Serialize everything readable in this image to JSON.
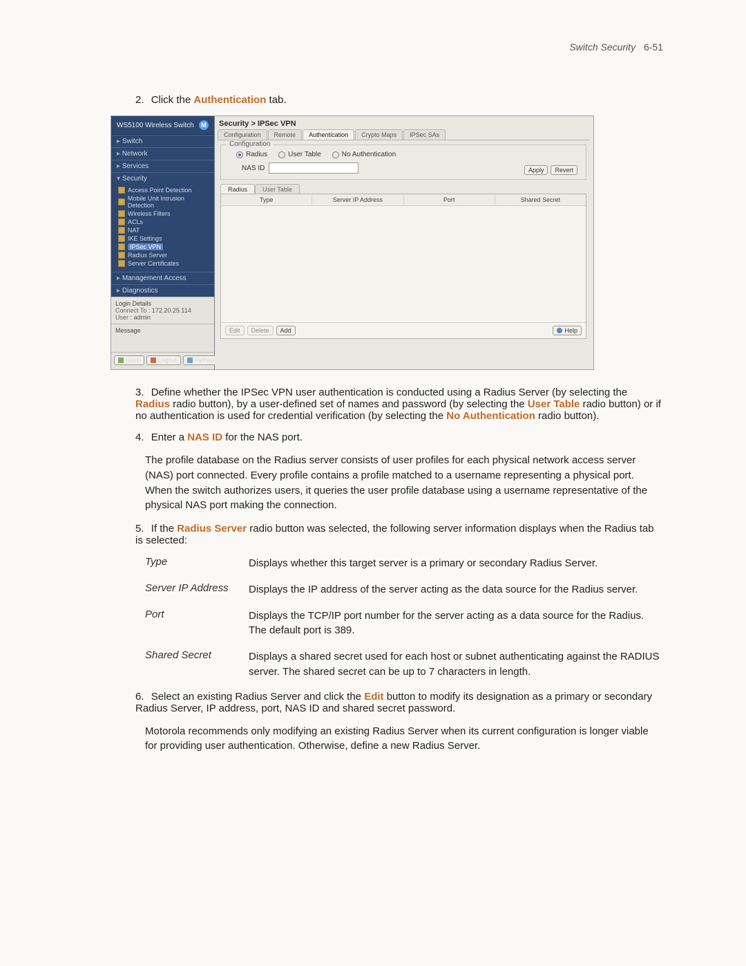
{
  "header": {
    "section": "Switch Security",
    "pageref": "6-51"
  },
  "steps": {
    "s2": {
      "num": "2.",
      "prefix": "Click the ",
      "accent": "Authentication",
      "suffix": " tab."
    },
    "s3": {
      "num": "3.",
      "t1": "Define whether the IPSec VPN user authentication is conducted using a Radius Server (by selecting the ",
      "a1": "Radius",
      "t2": " radio button), by a user-defined set of names and password (by selecting the ",
      "a2": "User Table",
      "t3": " radio button) or if no authentication is used for credential verification (by selecting the ",
      "a3": "No Authentication",
      "t4": " radio button)."
    },
    "s4": {
      "num": "4.",
      "t1": "Enter a ",
      "a1": "NAS ID",
      "t2": " for the NAS port.",
      "para": "The profile database on the Radius server consists of user profiles for each physical network access server (NAS) port connected. Every profile contains a profile matched to a username representing a physical port. When the switch authorizes users, it queries the user profile database using a username representative of the physical NAS port making the connection."
    },
    "s5": {
      "num": "5.",
      "t1": "If the ",
      "a1": "Radius Server",
      "t2": " radio button was selected, the following server information displays when the Radius tab is selected:"
    },
    "s6": {
      "num": "6.",
      "t1": "Select an existing Radius Server and click the ",
      "a1": "Edit",
      "t2": " button to modify its designation as a primary or secondary Radius Server, IP address, port, NAS ID and shared secret password.",
      "para": "Motorola recommends only modifying an existing Radius Server when its current configuration is longer viable for providing user authentication. Otherwise, define a new Radius Server."
    }
  },
  "defs": [
    {
      "term": "Type",
      "def": "Displays whether this target server is a primary or secondary Radius Server."
    },
    {
      "term": "Server IP Address",
      "def": "Displays the IP address of the server acting as the data source for the Radius server."
    },
    {
      "term": "Port",
      "def": "Displays the TCP/IP port number for the server acting as a data source for the Radius. The default port is 389."
    },
    {
      "term": "Shared Secret",
      "def": "Displays a shared secret used for each host or subnet authenticating against the RADIUS server. The shared secret can be up to 7 characters in length."
    }
  ],
  "ui": {
    "brand": {
      "name": "WS5100 Wireless Switch",
      "logoLetter": "M"
    },
    "nav": {
      "items": [
        "Switch",
        "Network",
        "Services",
        "Security",
        "Management Access",
        "Diagnostics"
      ],
      "tree": [
        "Access Point Detection",
        "Mobile Unit Intrusion Detection",
        "Wireless Filters",
        "ACLs",
        "NAT",
        "IKE Settings",
        "IPSec VPN",
        "Radius Server",
        "Server Certificates"
      ]
    },
    "login": {
      "title": "Login Details",
      "connectLbl": "Connect To :",
      "connectVal": "172.20.25.114",
      "userLbl": "User :",
      "userVal": "admin"
    },
    "message": {
      "title": "Message"
    },
    "bottomButtons": {
      "save": "Save",
      "logout": "Logout",
      "refresh": "Refresh"
    },
    "breadcrumb": "Security > IPSec VPN",
    "tabs": [
      "Configuration",
      "Remote",
      "Authentication",
      "Crypto Maps",
      "IPSec SAs"
    ],
    "config": {
      "legend": "Configuration",
      "radios": {
        "r1": "Radius",
        "r2": "User Table",
        "r3": "No Authentication"
      },
      "nasLabel": "NAS ID",
      "apply": "Apply",
      "revert": "Revert"
    },
    "subtabs": {
      "radius": "Radius",
      "usertable": "User Table"
    },
    "columns": [
      "Type",
      "Server IP Address",
      "Port",
      "Shared Secret"
    ],
    "footerButtons": {
      "edit": "Edit",
      "delete": "Delete",
      "add": "Add",
      "help": "Help"
    }
  }
}
